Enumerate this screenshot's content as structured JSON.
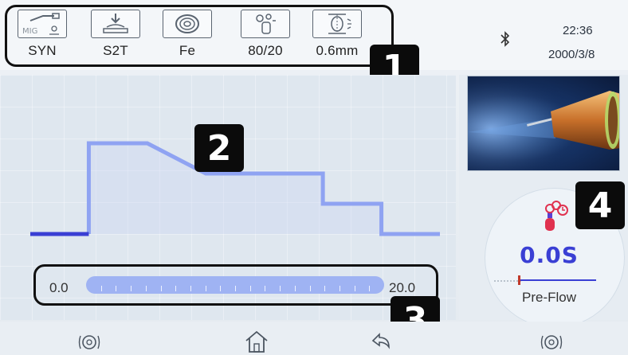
{
  "top_bar": {
    "modes": [
      {
        "icon": "mig-torch-icon",
        "label": "SYN",
        "sub_text": "MIG"
      },
      {
        "icon": "trigger-mode-icon",
        "label": "S2T"
      },
      {
        "icon": "wire-spool-icon",
        "label": "Fe"
      },
      {
        "icon": "gas-mix-icon",
        "label": "80/20"
      },
      {
        "icon": "wire-diameter-icon",
        "label": "0.6mm"
      }
    ],
    "bluetooth_icon": "bluetooth-icon",
    "time": "22:36",
    "date": "2000/3/8"
  },
  "callouts": [
    "1",
    "2",
    "3",
    "4"
  ],
  "chart_data": {
    "type": "line",
    "description": "welding parameter profile (step waveform)",
    "x": [
      0,
      1,
      1,
      2,
      3,
      4,
      5,
      5,
      6,
      6,
      7
    ],
    "y": [
      0,
      0,
      3,
      3,
      2,
      2,
      2,
      1,
      1,
      0,
      0
    ]
  },
  "slider": {
    "min_label": "0.0",
    "max_label": "20.0",
    "value": 0.0,
    "tick_count": 19
  },
  "side_panel": {
    "value": "0.0S",
    "label": "Pre-Flow",
    "icon": "gas-cylinder-icon"
  },
  "bottom_bar": {
    "buttons": [
      "left-knob-icon",
      "home-icon",
      "back-icon",
      "right-knob-icon"
    ]
  },
  "colors": {
    "waveform": "#8fa3f2",
    "waveform_active": "#3a3fd4",
    "accent": "#3a3fd4",
    "callout": "#0b0b0b"
  }
}
